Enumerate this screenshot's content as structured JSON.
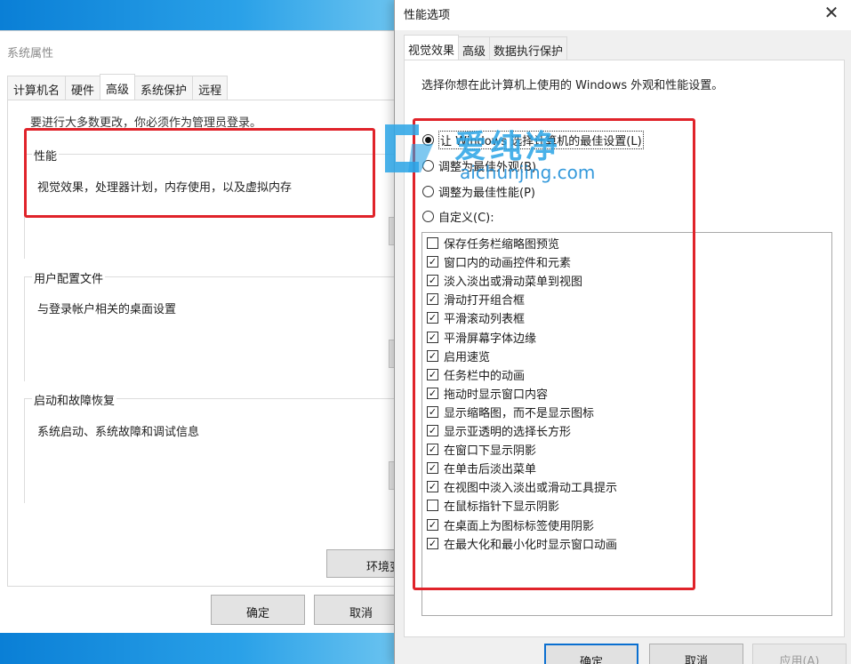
{
  "system_properties": {
    "title": "系统属性",
    "tabs": [
      "计算机名",
      "硬件",
      "高级",
      "系统保护",
      "远程"
    ],
    "active_tab_index": 2,
    "admin_note": "要进行大多数更改，你必须作为管理员登录。",
    "groups": [
      {
        "title": "性能",
        "description": "视觉效果，处理器计划，内存使用，以及虚拟内存"
      },
      {
        "title": "用户配置文件",
        "description": "与登录帐户相关的桌面设置"
      },
      {
        "title": "启动和故障恢复",
        "description": "系统启动、系统故障和调试信息"
      }
    ],
    "env_button_label": "环境变",
    "ok_label": "确定",
    "cancel_label": "取消"
  },
  "performance_options": {
    "title": "性能选项",
    "close_glyph": "✕",
    "tabs": [
      "视觉效果",
      "高级",
      "数据执行保护"
    ],
    "active_tab_index": 0,
    "intro": "选择你想在此计算机上使用的 Windows 外观和性能设置。",
    "radio_options": [
      {
        "label": "让 Windows 选择计算机的最佳设置(L)",
        "checked": true
      },
      {
        "label": "调整为最佳外观(B)",
        "checked": false
      },
      {
        "label": "调整为最佳性能(P)",
        "checked": false
      },
      {
        "label": "自定义(C):",
        "checked": false
      }
    ],
    "effects": [
      {
        "label": "保存任务栏缩略图预览",
        "checked": false
      },
      {
        "label": "窗口内的动画控件和元素",
        "checked": true
      },
      {
        "label": "淡入淡出或滑动菜单到视图",
        "checked": true
      },
      {
        "label": "滑动打开组合框",
        "checked": true
      },
      {
        "label": "平滑滚动列表框",
        "checked": true
      },
      {
        "label": "平滑屏幕字体边缘",
        "checked": true
      },
      {
        "label": "启用速览",
        "checked": true
      },
      {
        "label": "任务栏中的动画",
        "checked": true
      },
      {
        "label": "拖动时显示窗口内容",
        "checked": true
      },
      {
        "label": "显示缩略图，而不是显示图标",
        "checked": true
      },
      {
        "label": "显示亚透明的选择长方形",
        "checked": true
      },
      {
        "label": "在窗口下显示阴影",
        "checked": true
      },
      {
        "label": "在单击后淡出菜单",
        "checked": true
      },
      {
        "label": "在视图中淡入淡出或滑动工具提示",
        "checked": true
      },
      {
        "label": "在鼠标指针下显示阴影",
        "checked": false
      },
      {
        "label": "在桌面上为图标标签使用阴影",
        "checked": true
      },
      {
        "label": "在最大化和最小化时显示窗口动画",
        "checked": true
      }
    ],
    "ok_label": "确定",
    "cancel_label": "取消",
    "apply_label": "应用(A)"
  },
  "watermark": {
    "text_cn": "爱纯净",
    "text_en": "aichunjing.com"
  },
  "colors": {
    "highlight": "#e0232a",
    "accent": "#0a6fd0",
    "watermark": "#2aa4e6"
  }
}
